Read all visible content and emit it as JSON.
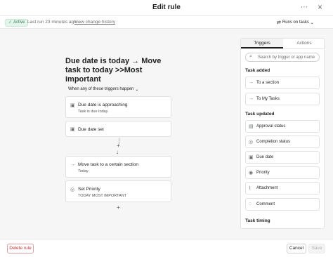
{
  "header": {
    "title": "Edit rule",
    "more_icon": "more-icon",
    "close_icon": "close-icon"
  },
  "status": {
    "badge": "Active",
    "last_run": "Last run 23 minutes ago",
    "separator": "·",
    "history_link": "View change history",
    "runs_on": "Runs on tasks"
  },
  "rule": {
    "title": "Due date is today → Move task to today >>Most important",
    "when_label": "When any of these triggers happen",
    "triggers": [
      {
        "icon": "calendar-icon",
        "label": "Due date is approaching",
        "sub": "Task is due today"
      },
      {
        "icon": "calendar-icon",
        "label": "Due date set",
        "sub": ""
      }
    ],
    "actions": [
      {
        "icon": "arrow-right-icon",
        "label": "Move task to a certain section",
        "sub": "Today"
      },
      {
        "icon": "check-circle-icon",
        "label": "Set Priority",
        "sub": "TODAY MOST IMPORTANT"
      }
    ]
  },
  "panel": {
    "tabs": [
      {
        "label": "Triggers",
        "active": true
      },
      {
        "label": "Actions",
        "active": false
      }
    ],
    "search_placeholder": "Search by trigger or app name",
    "sections": [
      {
        "heading": "Task added",
        "items": [
          {
            "icon": "arrow-right-icon",
            "label": "To a section"
          },
          {
            "icon": "arrow-right-icon",
            "label": "To My Tasks"
          }
        ]
      },
      {
        "heading": "Task updated",
        "items": [
          {
            "icon": "approval-icon",
            "label": "Approval status"
          },
          {
            "icon": "check-circle-icon",
            "label": "Completion status"
          },
          {
            "icon": "calendar-icon",
            "label": "Due date"
          },
          {
            "icon": "priority-icon",
            "label": "Priority"
          },
          {
            "icon": "paperclip-icon",
            "label": "Attachment"
          },
          {
            "icon": "comment-icon",
            "label": "Comment"
          }
        ]
      },
      {
        "heading": "Task timing",
        "items": []
      }
    ]
  },
  "footer": {
    "delete_label": "Delete rule",
    "cancel_label": "Cancel",
    "save_label": "Save"
  },
  "colors": {
    "active_badge_bg": "#e4f5ec",
    "delete_text": "#c0303c",
    "canvas_bg": "#f6f6f6"
  }
}
